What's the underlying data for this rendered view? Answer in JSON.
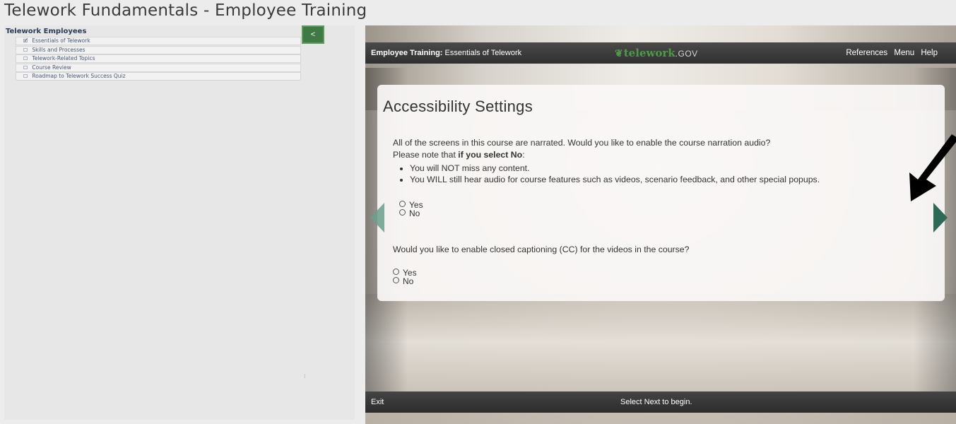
{
  "page": {
    "title": "Telework Fundamentals - Employee Training"
  },
  "sidebar": {
    "header": "Telework Employees",
    "collapse_label": "<",
    "resize_glyph": "⁝",
    "items": [
      {
        "label": "Essentials of Telework",
        "icon": "edit-icon",
        "glyph": "🗹"
      },
      {
        "label": "Skills and Processes",
        "icon": "checkbox-icon",
        "glyph": "☐"
      },
      {
        "label": "Telework-Related Topics",
        "icon": "checkbox-icon",
        "glyph": "☐"
      },
      {
        "label": "Course Review",
        "icon": "checkbox-icon",
        "glyph": "☐"
      },
      {
        "label": "Roadmap to Telework Success Quiz",
        "icon": "checkbox-icon",
        "glyph": "☐"
      }
    ]
  },
  "course": {
    "title_prefix": "Employee Training:",
    "title_suffix": " Essentials of Telework",
    "logo_word": "telework",
    "logo_tld": ".GOV",
    "nav": [
      "References",
      "Menu",
      "Help"
    ],
    "exit_label": "Exit",
    "status_text": "Select Next to begin.",
    "accent_color": "#4f9a4a",
    "arrow_color": "#2e6a55"
  },
  "card": {
    "heading": "Accessibility Settings",
    "q1_text": "All of the screens in this course are narrated. Would you like to enable the course narration audio?",
    "note_prefix": "Please note that ",
    "note_bold": "if you select No",
    "note_suffix": ":",
    "bullets": [
      "You will NOT miss any content.",
      "You WILL still hear audio for course features such as videos, scenario feedback, and other special popups."
    ],
    "q1_options": [
      "Yes",
      "No"
    ],
    "q2_text": "Would you like to enable closed captioning (CC) for the videos in the course?",
    "q2_options": [
      "Yes",
      "No"
    ]
  }
}
